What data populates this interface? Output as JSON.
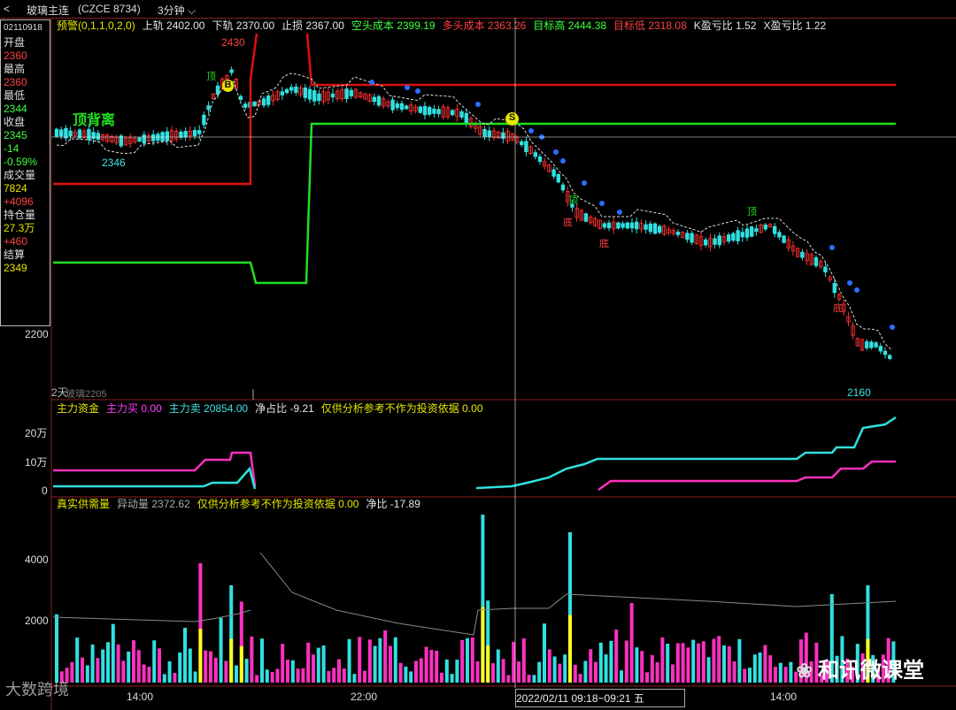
{
  "titlebar": {
    "back": "<",
    "symbol": "玻璃主连",
    "code": "(CZCE 8734)",
    "period": "3分钟"
  },
  "infopanel": {
    "date": "02110918",
    "items": [
      {
        "label": "开盘",
        "value": "2360",
        "color": "#ff4040"
      },
      {
        "label": "最高",
        "value": "2360",
        "color": "#ff4040"
      },
      {
        "label": "最低",
        "value": "2344",
        "color": "#40ff40"
      },
      {
        "label": "收盘",
        "value": "2345",
        "color": "#40ff40"
      },
      {
        "label": "",
        "value": "-14",
        "color": "#40ff40"
      },
      {
        "label": "",
        "value": "-0.59%",
        "color": "#40ff40"
      },
      {
        "label": "成交量",
        "value": "7824",
        "color": "#e6e600"
      },
      {
        "label": "",
        "value": "+4096",
        "color": "#ff4040"
      },
      {
        "label": "持仓量",
        "value": "27.3万",
        "color": "#e6e600"
      },
      {
        "label": "",
        "value": "+460",
        "color": "#ff4040"
      },
      {
        "label": "结算",
        "value": "2349",
        "color": "#e6e600"
      }
    ]
  },
  "main_header": [
    {
      "text": "预警(0,1,1,0,2,0)",
      "color": "#e6e600"
    },
    {
      "text": "上轨 2402.00",
      "color": "#e6e6e6"
    },
    {
      "text": "下轨 2370.00",
      "color": "#e6e6e6"
    },
    {
      "text": "止损 2367.00",
      "color": "#e6e6e6"
    },
    {
      "text": "空头成本 2399.19",
      "color": "#40ff40"
    },
    {
      "text": "多头成本 2363.26",
      "color": "#ff4040"
    },
    {
      "text": "目标高 2444.38",
      "color": "#40ff40"
    },
    {
      "text": "目标低 2318.08",
      "color": "#ff4040"
    },
    {
      "text": "K盈亏比 1.52",
      "color": "#e6e6e6"
    },
    {
      "text": "X盈亏比 1.22",
      "color": "#e6e6e6"
    }
  ],
  "main_labels": {
    "y_2200": "2200",
    "top_divergence": "顶背离",
    "price_2430": "2430",
    "price_2346": "2346",
    "price_2160": "2160",
    "bottom_left": "2天",
    "bottom_left2": "玻璃2205",
    "marker_B": "B",
    "marker_S": "S",
    "top_marks": [
      "顶",
      "顶",
      "顶"
    ],
    "bottom_marks": [
      "底",
      "底",
      "底"
    ]
  },
  "fund_header": [
    {
      "text": "主力资金",
      "color": "#e6e600"
    },
    {
      "text": "主力买 0.00",
      "color": "#ff40ff"
    },
    {
      "text": "主力卖 20854.00",
      "color": "#40e0e0"
    },
    {
      "text": "净占比 -9.21",
      "color": "#e6e6e6"
    },
    {
      "text": "仅供分析参考不作为投资依据 0.00",
      "color": "#e6e600"
    }
  ],
  "fund_axis": [
    "20万",
    "10万",
    "0"
  ],
  "volume_header": [
    {
      "text": "真实供需量",
      "color": "#e6e600"
    },
    {
      "text": "异动量 2372.62",
      "color": "#aaaaaa"
    },
    {
      "text": "仅供分析参考不作为投资依据 0.00",
      "color": "#e6e600"
    },
    {
      "text": "净比 -17.89",
      "color": "#e6e6e6"
    }
  ],
  "volume_axis": [
    "4000",
    "2000"
  ],
  "time_axis": [
    "14:00",
    "22:00",
    "14:00"
  ],
  "cursor_time": "2022/02/11 09:18~09:21 五",
  "watermark": "和讯微课堂",
  "watermark2": "大数跨境",
  "colors": {
    "up": "#ff3030",
    "down": "#30e0e0",
    "upper_band": "#e01010",
    "lower_band": "#20e020"
  }
}
